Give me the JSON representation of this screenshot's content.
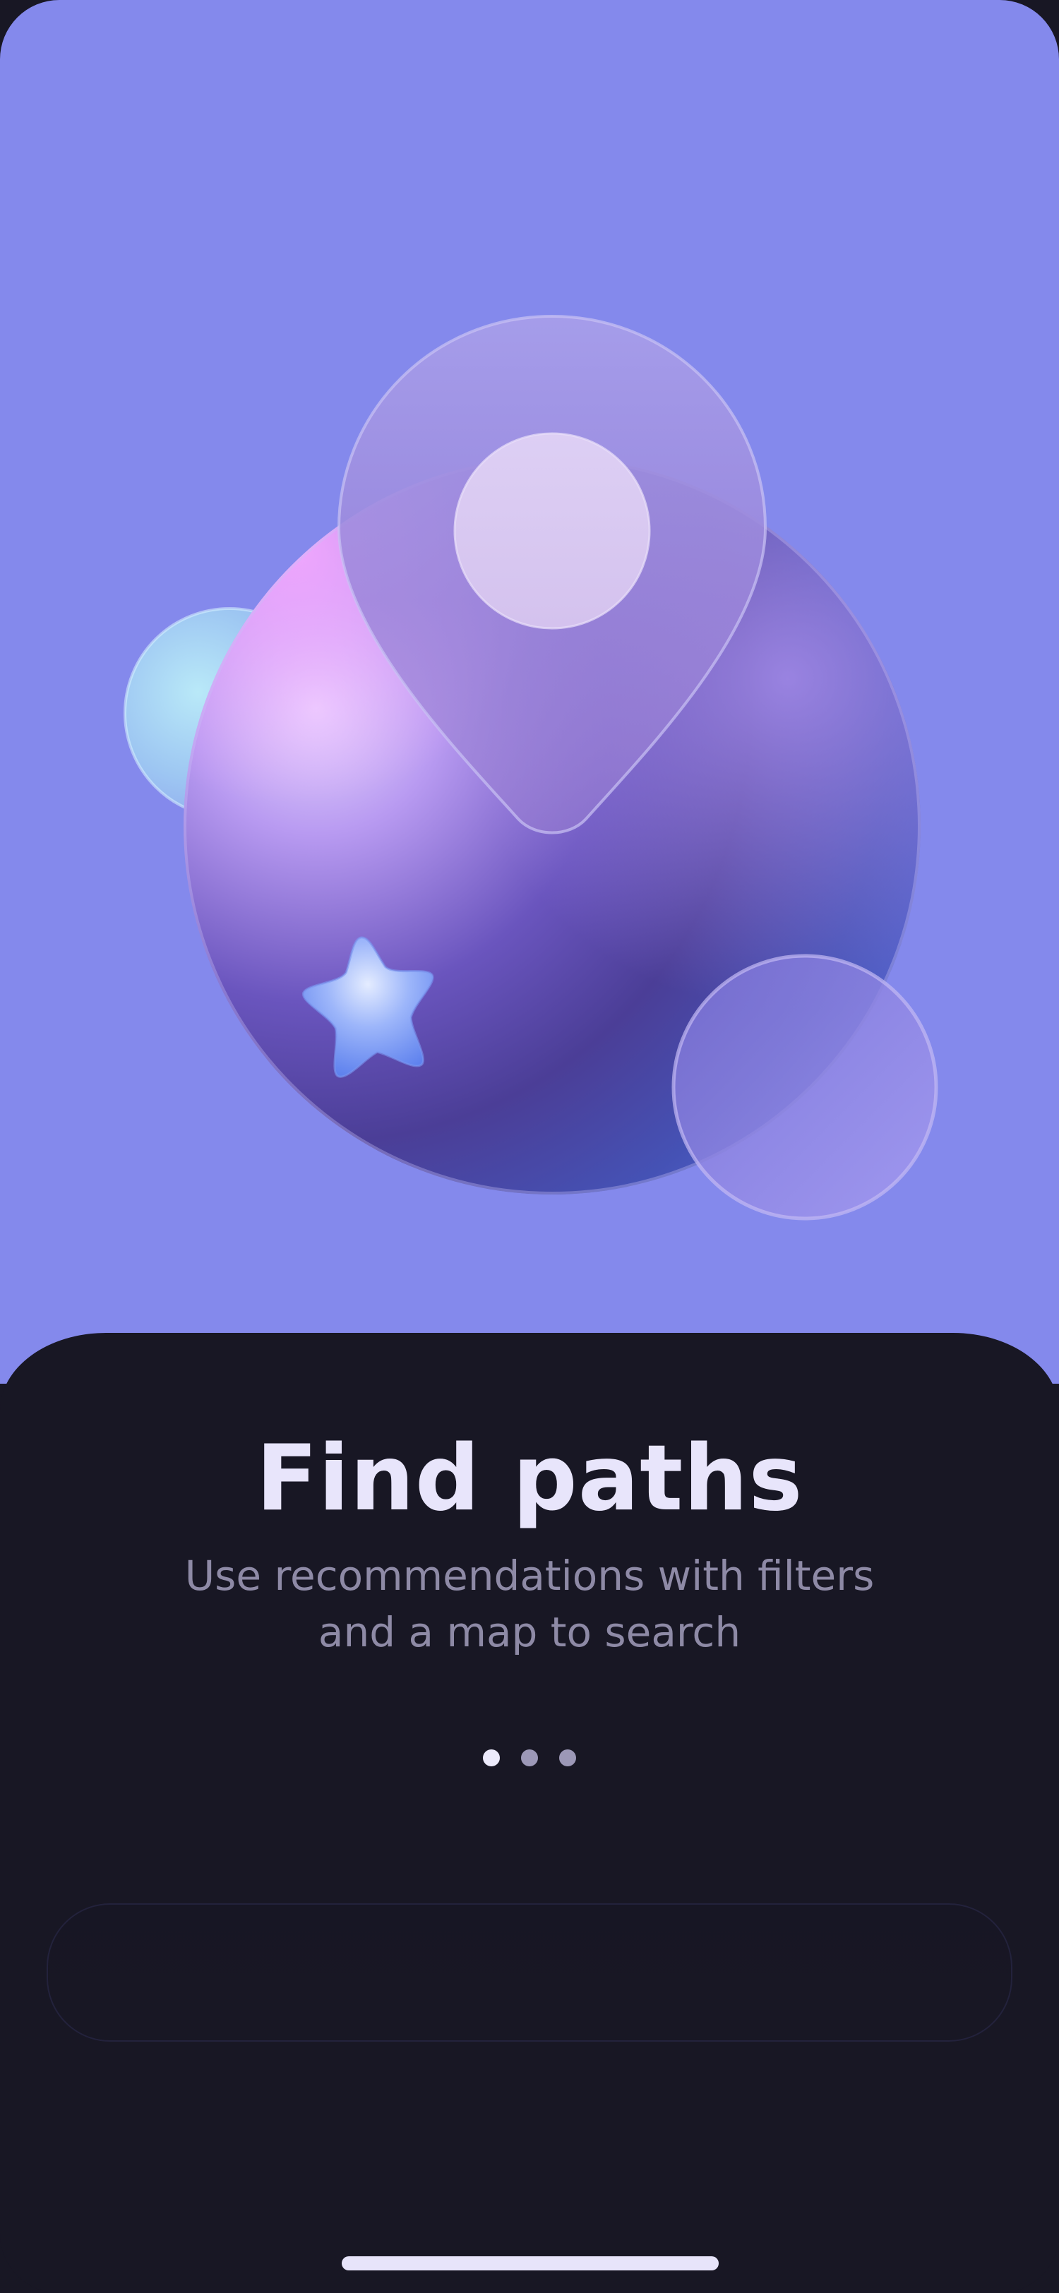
{
  "onboarding": {
    "title": "Find paths",
    "description": "Use recommendations with filters and a map to search",
    "pagination": {
      "total_pages": 3,
      "current_page": 1
    },
    "primary_button_label": ""
  },
  "colors": {
    "hero_background": "#8489EC",
    "sheet_background": "#181724",
    "title_text": "#E8E5FB",
    "description_text": "#8E8AA6",
    "dot_active": "#ECEAFB",
    "dot_inactive": "#9C98B7",
    "home_indicator": "#E7E4FA"
  },
  "illustration": {
    "icons": [
      "globe-sphere",
      "location-pin-icon",
      "star-icon",
      "small-bubble-left",
      "small-bubble-right"
    ]
  }
}
